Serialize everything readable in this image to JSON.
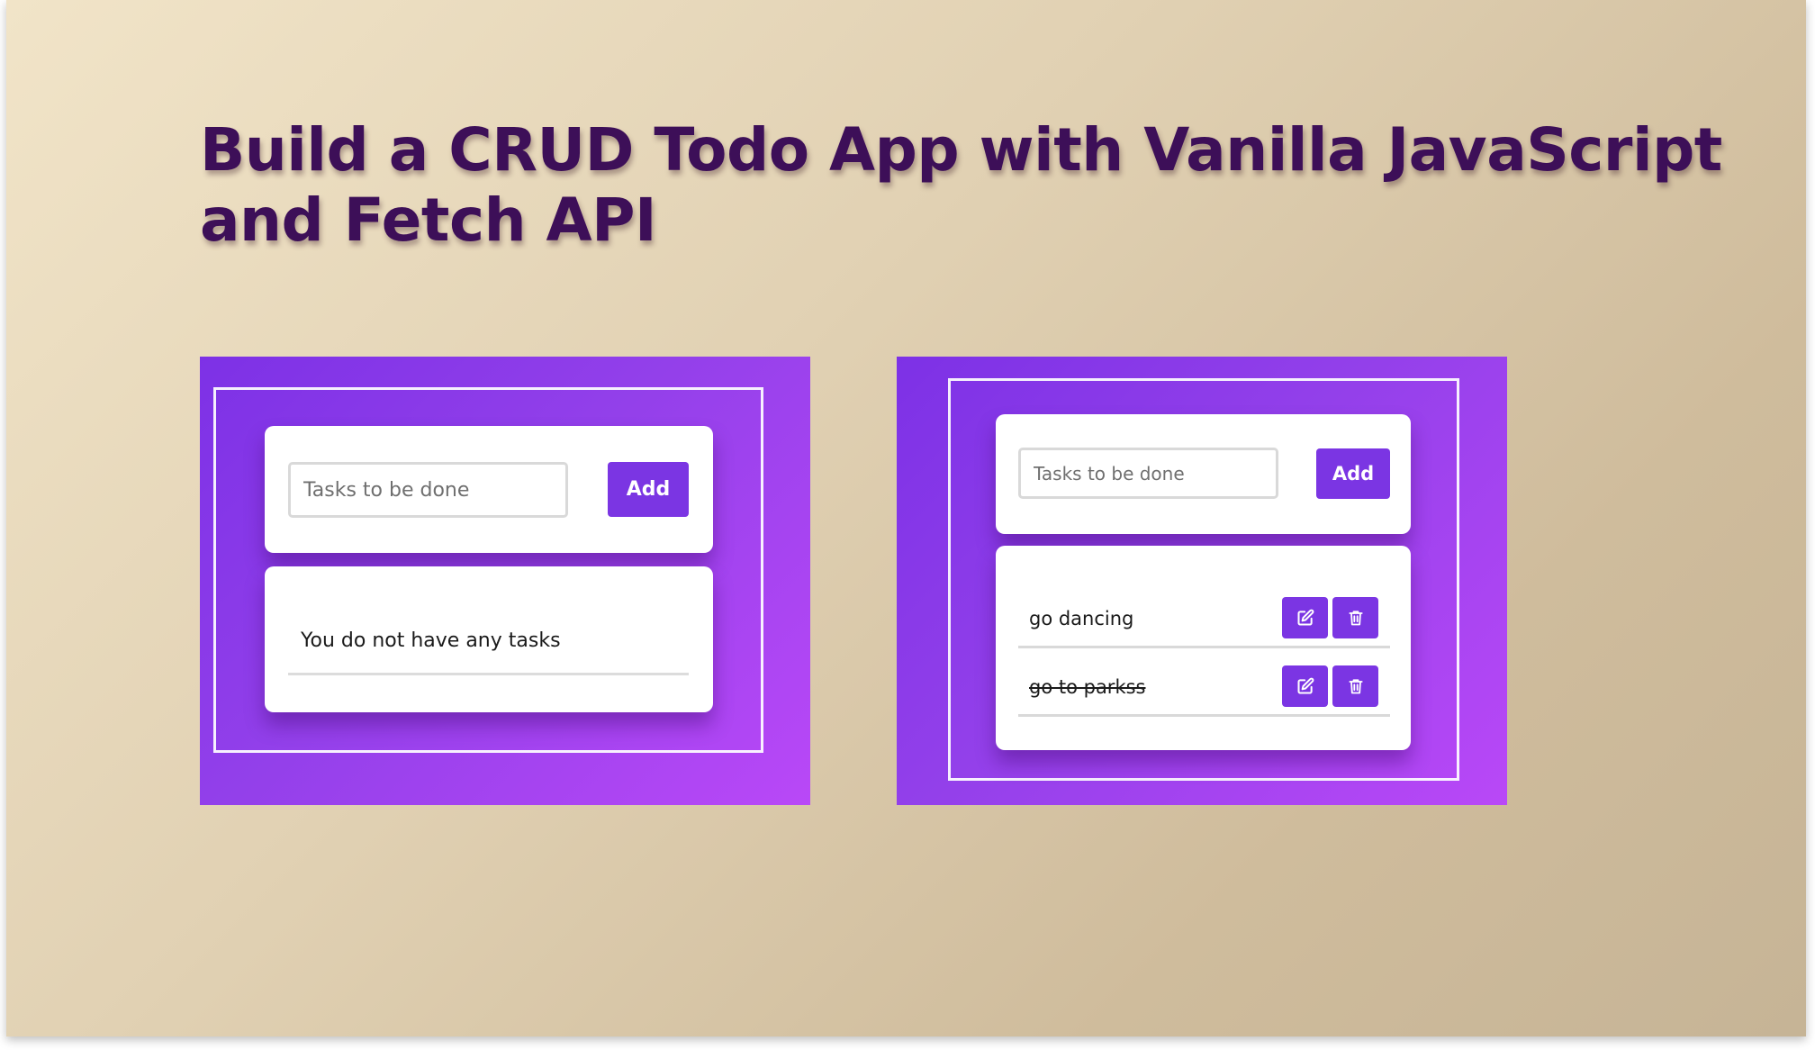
{
  "title_lines": [
    "Build a CRUD Todo App with Vanilla JavaScript",
    "and Fetch API"
  ],
  "colors": {
    "title": "#3d0f58",
    "panel_gradient_start": "#7d31e6",
    "panel_gradient_end": "#b948f7",
    "button": "#7b35e3",
    "page_gradient_start": "#f1e4c8",
    "page_gradient_end": "#c6b496"
  },
  "empty_app": {
    "input_placeholder": "Tasks to be done",
    "add_label": "Add",
    "empty_message": "You do not have any tasks"
  },
  "filled_app": {
    "input_placeholder": "Tasks to be done",
    "add_label": "Add",
    "tasks": [
      {
        "text": "go dancing",
        "completed": false,
        "edit_icon": "edit-icon",
        "delete_icon": "trash-icon"
      },
      {
        "text": "go to parkss",
        "completed": true,
        "edit_icon": "edit-icon",
        "delete_icon": "trash-icon"
      }
    ]
  }
}
